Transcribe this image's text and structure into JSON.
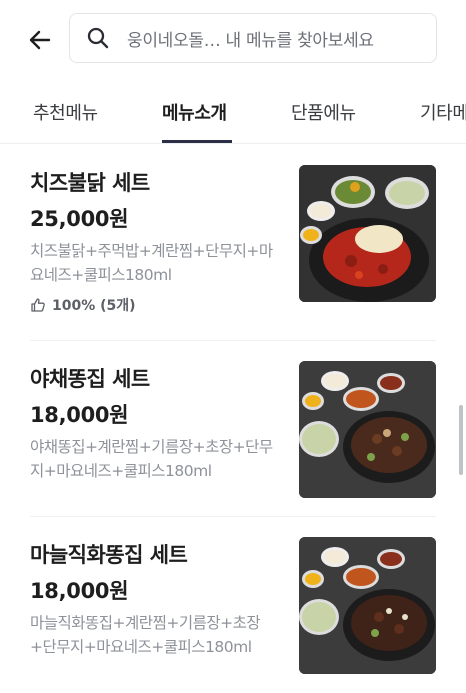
{
  "header": {
    "back_icon": "arrow-left-icon",
    "search_icon": "search-icon",
    "search_placeholder": "웅이네오돌… 내 메뉴를 찾아보세요"
  },
  "tabs": [
    {
      "label": "추천메뉴",
      "active": false
    },
    {
      "label": "메뉴소개",
      "active": true
    },
    {
      "label": "단품에뉴",
      "active": false
    },
    {
      "label": "기타메",
      "active": false
    }
  ],
  "menu_items": [
    {
      "name": "치즈불닭 세트",
      "price": "25,000원",
      "description": "치즈불닭+주먹밥+계란찜+단무지+마요네즈+쿨피스180ml",
      "rating": "100% (5개)"
    },
    {
      "name": "야채똥집 세트",
      "price": "18,000원",
      "description": "야채똥집+계란찜+기름장+초장+단무지+마요네즈+쿨피스180ml"
    },
    {
      "name": "마늘직화똥집 세트",
      "price": "18,000원",
      "description": "마늘직화똥집+계란찜+기름장+초장+단무지+마요네즈+쿨피스180ml"
    }
  ],
  "colors": {
    "tab_indicator": "#2b2f45",
    "text_primary": "#1e1e1e",
    "text_secondary": "#8e9299"
  }
}
